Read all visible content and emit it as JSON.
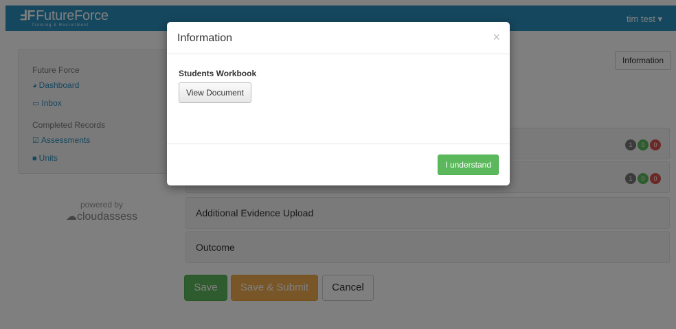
{
  "navbar": {
    "brand_mark": "ℲF",
    "brand_name": "FutureForce",
    "brand_tagline": "Training & Recruitment",
    "user_menu": "tim test ▾"
  },
  "sidebar": {
    "section1_title": "Future Force",
    "items1": [
      {
        "icon": "dashboard-icon",
        "glyph": "◕",
        "label": "Dashboard"
      },
      {
        "icon": "inbox-icon",
        "glyph": "▭",
        "label": "Inbox"
      }
    ],
    "section2_title": "Completed Records",
    "items2": [
      {
        "icon": "check-square-icon",
        "glyph": "☑",
        "label": "Assessments"
      },
      {
        "icon": "book-icon",
        "glyph": "■",
        "label": "Units"
      }
    ]
  },
  "powered": {
    "by": "powered by",
    "logo": "☁cloudassess"
  },
  "header": {
    "information_button": "Information"
  },
  "panels": [
    {
      "label": "",
      "badges": [
        "1",
        "0",
        "0"
      ]
    },
    {
      "label": "",
      "badges": [
        "1",
        "0",
        "0"
      ]
    },
    {
      "label": "Additional Evidence Upload"
    },
    {
      "label": "Outcome"
    }
  ],
  "badge_colors": {
    "grey": "#777777",
    "green": "#5cb85c",
    "red": "#d9534f"
  },
  "actions": {
    "save": "Save",
    "save_submit": "Save & Submit",
    "cancel": "Cancel"
  },
  "modal": {
    "title": "Information",
    "close": "×",
    "document_title": "Students Workbook",
    "view_button": "View Document",
    "confirm_button": "I understand"
  }
}
